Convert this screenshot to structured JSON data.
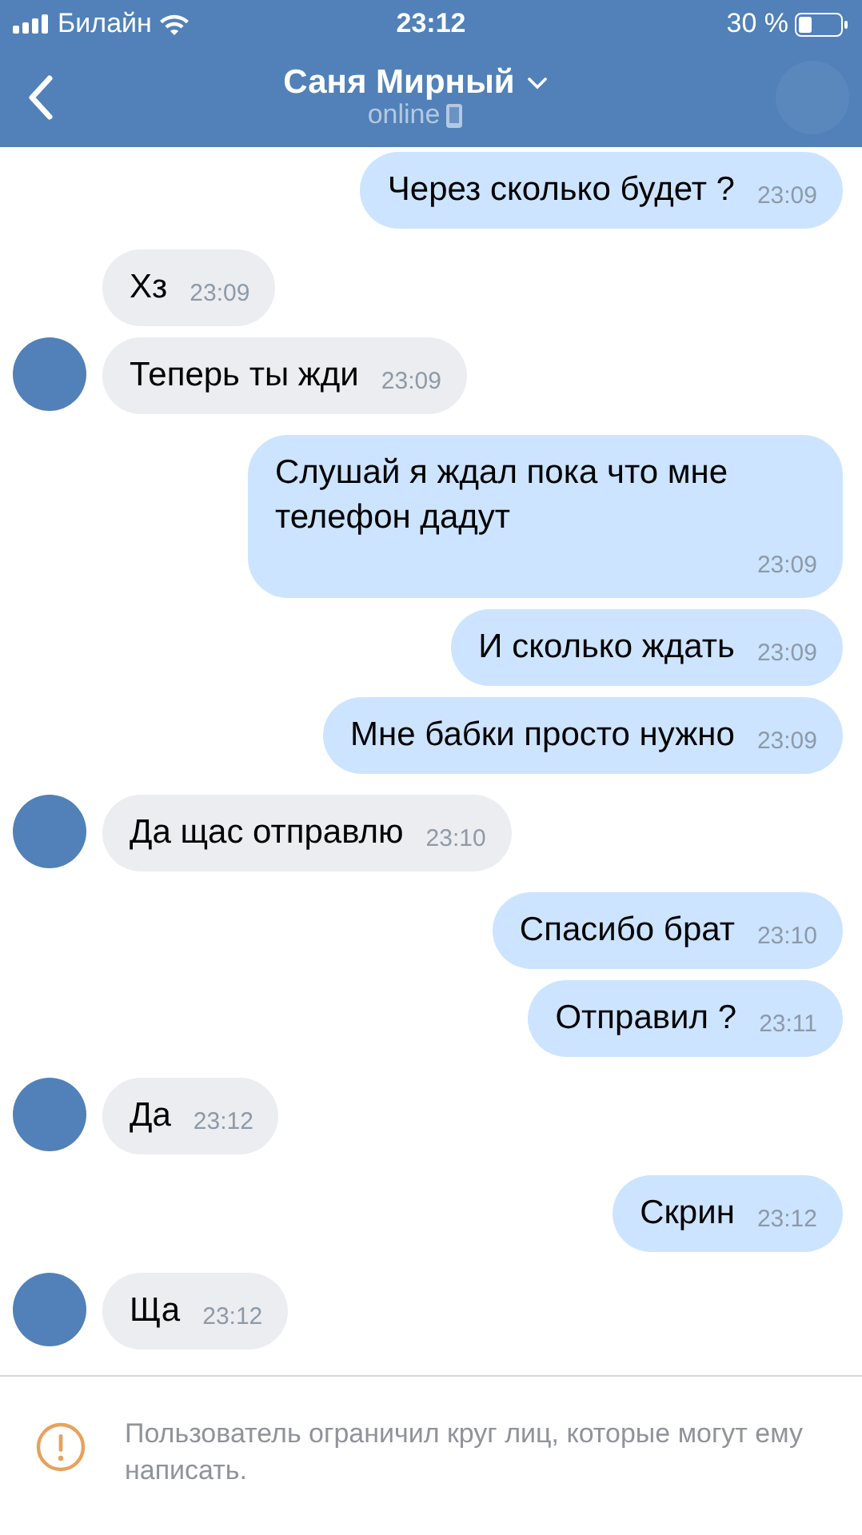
{
  "status_bar": {
    "carrier": "Билайн",
    "time": "23:12",
    "battery": "30 %"
  },
  "header": {
    "title": "Саня Мирный",
    "subtitle": "online"
  },
  "messages": [
    {
      "kind": "outgoing",
      "text": "Через сколько будет ?",
      "time": "23:09"
    },
    {
      "kind": "incoming",
      "text": "Хз",
      "time": "23:09",
      "avatar": false
    },
    {
      "kind": "incoming",
      "text": "Теперь ты жди",
      "time": "23:09",
      "avatar": true
    },
    {
      "kind": "outgoing",
      "text": "Слушай я ждал пока что мне телефон дадут",
      "time": "23:09"
    },
    {
      "kind": "outgoing",
      "text": "И сколько ждать",
      "time": "23:09"
    },
    {
      "kind": "outgoing",
      "text": "Мне бабки просто нужно",
      "time": "23:09"
    },
    {
      "kind": "incoming",
      "text": "Да щас отправлю",
      "time": "23:10",
      "avatar": true
    },
    {
      "kind": "outgoing",
      "text": "Спасибо брат",
      "time": "23:10"
    },
    {
      "kind": "outgoing",
      "text": "Отправил ?",
      "time": "23:11"
    },
    {
      "kind": "incoming",
      "text": "Да",
      "time": "23:12",
      "avatar": true
    },
    {
      "kind": "outgoing",
      "text": "Скрин",
      "time": "23:12"
    },
    {
      "kind": "incoming",
      "text": "Ща",
      "time": "23:12",
      "avatar": true
    }
  ],
  "notice": {
    "text": "Пользователь ограничил круг лиц, которые могут ему написать."
  }
}
